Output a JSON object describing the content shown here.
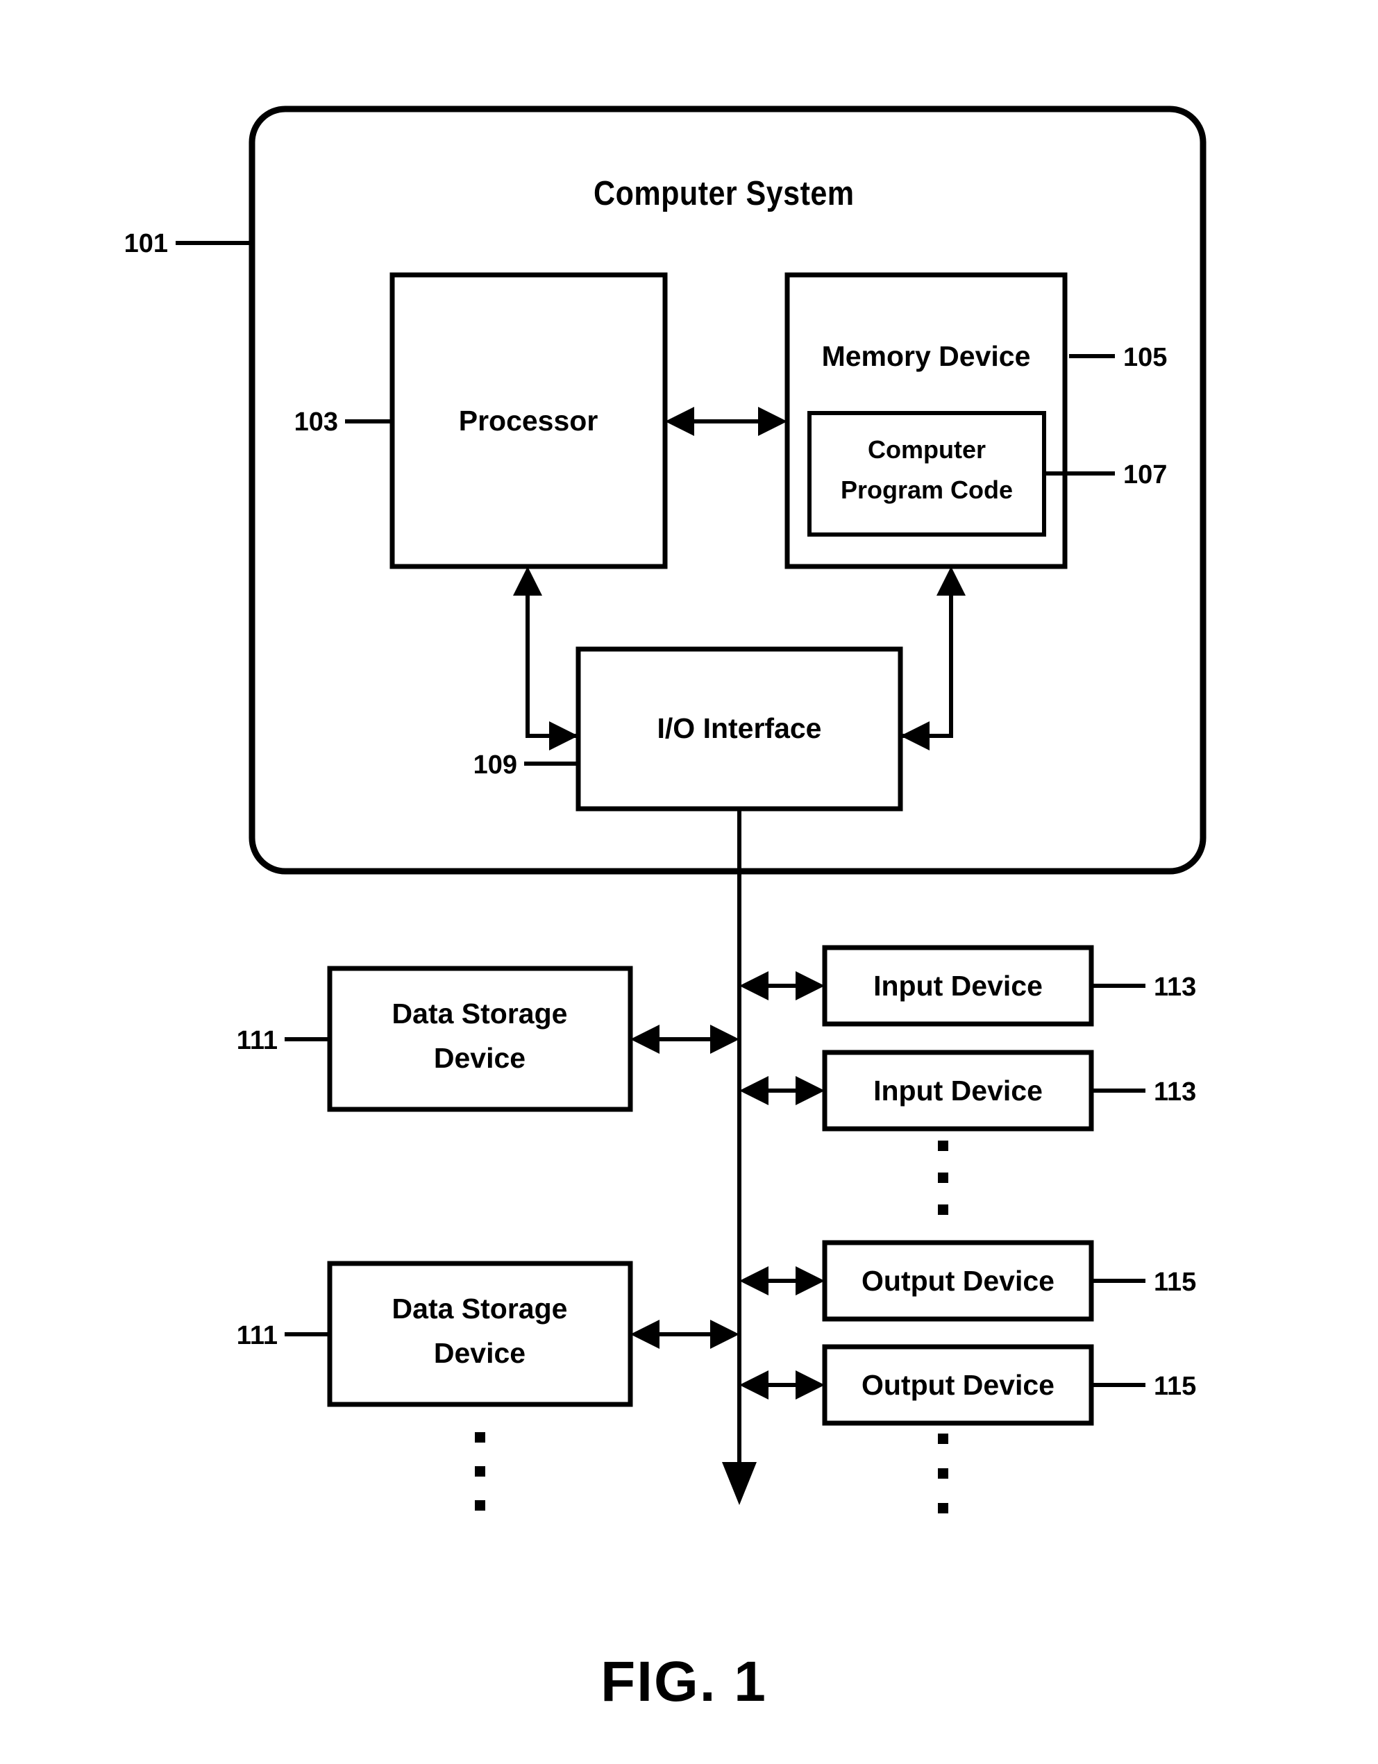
{
  "figure": {
    "caption": "FIG. 1",
    "system_title": "Computer System"
  },
  "blocks": {
    "computer_system": {
      "label": "Computer System",
      "ref": "101"
    },
    "processor": {
      "label": "Processor",
      "ref": "103"
    },
    "memory_device": {
      "label": "Memory Device",
      "ref": "105"
    },
    "computer_program_code": {
      "label_line1": "Computer",
      "label_line2": "Program Code",
      "ref": "107"
    },
    "io_interface": {
      "label": "I/O Interface",
      "ref": "109"
    },
    "data_storage_1": {
      "label_line1": "Data Storage",
      "label_line2": "Device",
      "ref": "111"
    },
    "data_storage_2": {
      "label_line1": "Data Storage",
      "label_line2": "Device",
      "ref": "111"
    },
    "input_device_1": {
      "label": "Input Device",
      "ref": "113"
    },
    "input_device_2": {
      "label": "Input Device",
      "ref": "113"
    },
    "output_device_1": {
      "label": "Output Device",
      "ref": "115"
    },
    "output_device_2": {
      "label": "Output Device",
      "ref": "115"
    }
  },
  "ellipsis": {
    "glyph": "▪",
    "input_column": "vertical-dots",
    "output_column": "vertical-dots",
    "storage_column": "vertical-dots"
  },
  "colors": {
    "ink": "#000000",
    "paper": "#ffffff"
  }
}
